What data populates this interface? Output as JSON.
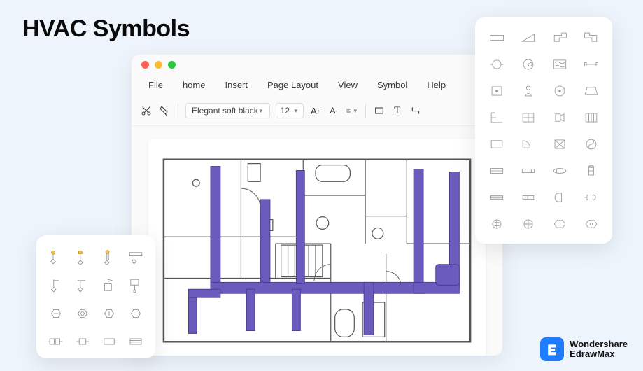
{
  "page": {
    "title": "HVAC Symbols"
  },
  "app": {
    "menu": [
      "File",
      "home",
      "Insert",
      "Page Layout",
      "View",
      "Symbol",
      "Help"
    ],
    "toolbar": {
      "font_name": "Elegant soft black",
      "font_size": "12"
    }
  },
  "brand": {
    "line1": "Wondershare",
    "line2": "EdrawMax"
  },
  "colors": {
    "accent_bg": "#eef4fb",
    "duct": "#6b5bbd",
    "brand_blue": "#1f7cff",
    "yellow": "#f3c04b"
  },
  "panels": {
    "right_symbols": [
      "rect",
      "tri-left",
      "elbow",
      "elbow-l",
      "valve-o",
      "fan",
      "wave",
      "pipe",
      "box-dot",
      "person",
      "circle-dot",
      "trapezoid",
      "frame",
      "grid",
      "fitting",
      "panel-lines",
      "rect2",
      "quarter",
      "box-x",
      "yin",
      "rect3",
      "bar",
      "oval",
      "cyl",
      "slot",
      "vent",
      "capsule",
      "coil",
      "bar2",
      "globe",
      "cross-circ",
      "hex",
      "hex2"
    ],
    "left_symbols": [
      "hex-probe-y",
      "hex-probe-y2",
      "hex-probe-y3",
      "plug-hex",
      "hex-line",
      "hex-bar",
      "box-flag",
      "box-stem",
      "hex-a",
      "hex-b",
      "hex-c",
      "hex-plain",
      "db-plug",
      "plug-sm",
      "rect-sm",
      "vent-sm"
    ]
  }
}
